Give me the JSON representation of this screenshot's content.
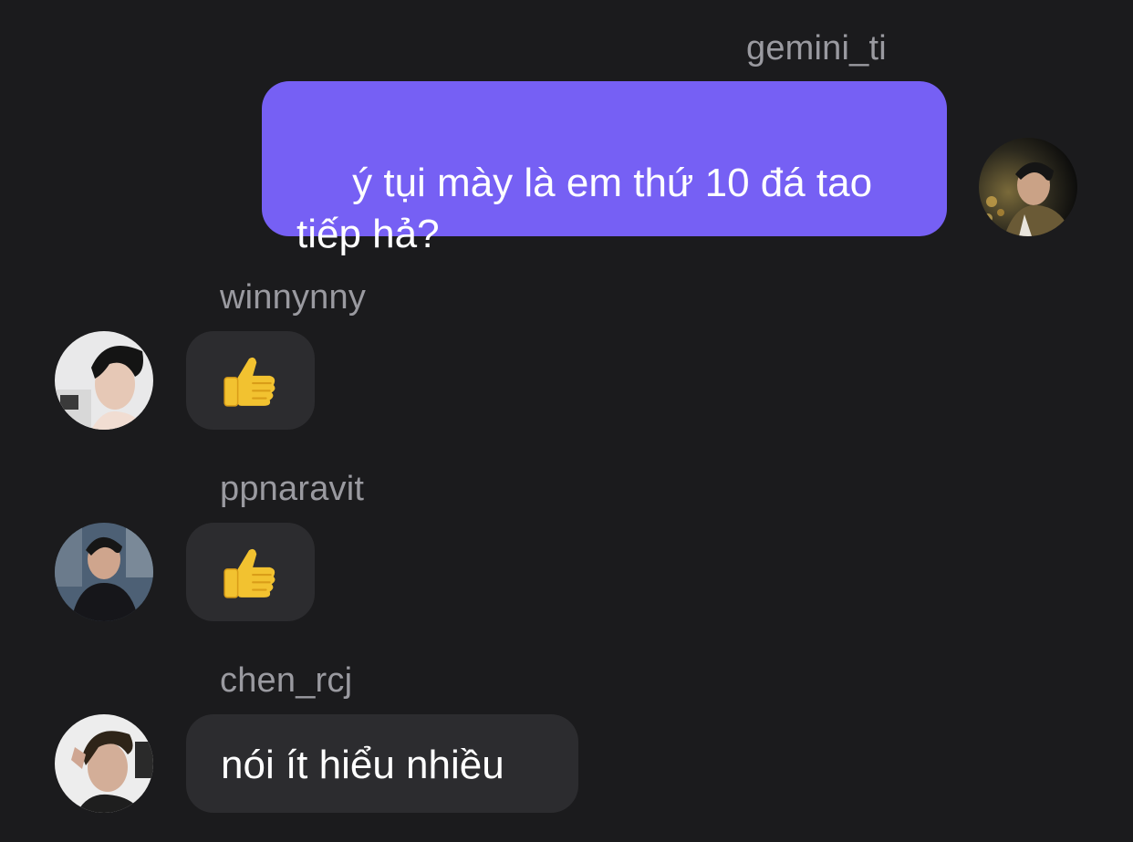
{
  "messages": [
    {
      "sender": "gemini_ti",
      "text": " ý tụi mày là em thứ 10 đá tao tiếp hả?",
      "direction": "outgoing"
    },
    {
      "sender": "winnynny",
      "reaction_icon": "thumbs-up-icon",
      "direction": "incoming"
    },
    {
      "sender": "ppnaravit",
      "reaction_icon": "thumbs-up-icon",
      "direction": "incoming"
    },
    {
      "sender": "chen_rcj",
      "text": "nói ít hiểu nhiều",
      "direction": "incoming"
    }
  ],
  "colors": {
    "background": "#1b1b1d",
    "outgoing_bubble": "#7660f4",
    "incoming_bubble": "#2c2c2f",
    "sender_name": "#9a9aa0",
    "thumbs_up": "#f2c230"
  }
}
